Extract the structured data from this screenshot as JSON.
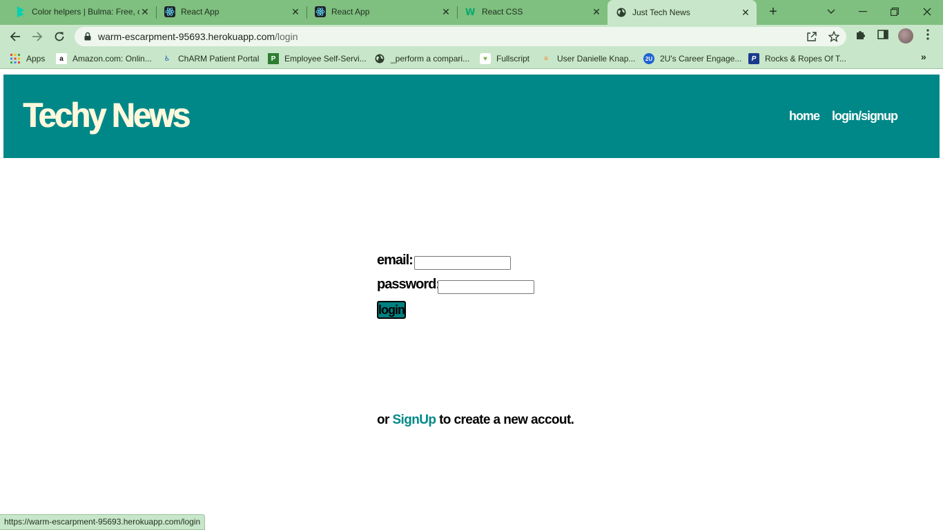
{
  "browser": {
    "tabs": [
      {
        "title": "Color helpers | Bulma: Free, o",
        "icon": "bulma-icon",
        "active": false
      },
      {
        "title": "React App",
        "icon": "react-icon",
        "active": false
      },
      {
        "title": "React App",
        "icon": "react-icon",
        "active": false
      },
      {
        "title": "React CSS",
        "icon": "w3-icon",
        "active": false
      },
      {
        "title": "Just Tech News",
        "icon": "globe-icon",
        "active": true
      }
    ],
    "url_host": "warm-escarpment-95693.herokuapp.com",
    "url_path": "/login",
    "bookmarks": [
      {
        "label": "Apps",
        "icon": "apps-grid-icon"
      },
      {
        "label": "Amazon.com: Onlin...",
        "icon": "amazon-icon"
      },
      {
        "label": "ChARM Patient Portal",
        "icon": "charm-icon"
      },
      {
        "label": "Employee Self-Servi...",
        "icon": "paylocity-icon"
      },
      {
        "label": "_perform a compari...",
        "icon": "globe-icon"
      },
      {
        "label": "Fullscript",
        "icon": "fullscript-icon"
      },
      {
        "label": "User Danielle Knap...",
        "icon": "stackoverflow-icon"
      },
      {
        "label": "2U's Career Engage...",
        "icon": "2u-icon"
      },
      {
        "label": "Rocks & Ropes Of T...",
        "icon": "paypal-icon"
      }
    ],
    "status_url": "https://warm-escarpment-95693.herokuapp.com/login"
  },
  "site": {
    "title": "Techy News",
    "nav": {
      "home": "home",
      "login": "login/signup"
    },
    "accent_color": "#008888",
    "title_color": "#fff8dc"
  },
  "login_form": {
    "email_label": "email:",
    "email_value": "",
    "password_label": "password:",
    "password_value": "",
    "submit_label": "login"
  },
  "signup": {
    "prefix": "or ",
    "link_text": "SignUp",
    "suffix": " to create a new accout."
  }
}
